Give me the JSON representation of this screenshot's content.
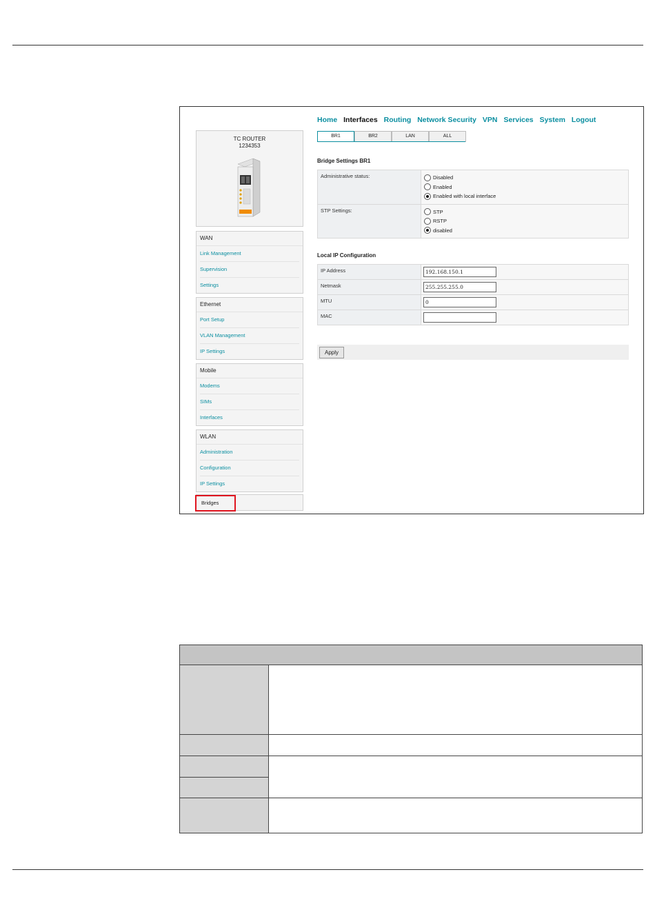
{
  "device": {
    "name": "TC ROUTER",
    "id": "1234353"
  },
  "nav": {
    "items": [
      "Home",
      "Interfaces",
      "Routing",
      "Network Security",
      "VPN",
      "Services",
      "System",
      "Logout"
    ],
    "active": "Interfaces"
  },
  "tabs": [
    "BR1",
    "BR2",
    "LAN",
    "ALL"
  ],
  "active_tab": "BR1",
  "sidebar": {
    "wan": {
      "header": "WAN",
      "items": [
        "Link Management",
        "Supervision",
        "Settings"
      ]
    },
    "ethernet": {
      "header": "Ethernet",
      "items": [
        "Port Setup",
        "VLAN Management",
        "IP Settings"
      ]
    },
    "mobile": {
      "header": "Mobile",
      "items": [
        "Modems",
        "SIMs",
        "Interfaces"
      ]
    },
    "wlan": {
      "header": "WLAN",
      "items": [
        "Administration",
        "Configuration",
        "IP Settings"
      ]
    },
    "bridges": "Bridges"
  },
  "bridge_settings": {
    "title": "Bridge Settings BR1",
    "admin_status": {
      "label": "Administrative status:",
      "options": [
        "Disabled",
        "Enabled",
        "Enabled with local interface"
      ],
      "selected": "Enabled with local interface"
    },
    "stp": {
      "label": "STP Settings:",
      "options": [
        "STP",
        "RSTP",
        "disabled"
      ],
      "selected": "disabled"
    }
  },
  "local_ip": {
    "title": "Local IP Configuration",
    "fields": {
      "ip_label": "IP Address",
      "ip_value": "192.168.150.1",
      "netmask_label": "Netmask",
      "netmask_value": "255.255.255.0",
      "mtu_label": "MTU",
      "mtu_value": "0",
      "mac_label": "MAC",
      "mac_value": ""
    }
  },
  "apply_label": "Apply",
  "colors": {
    "accent": "#0a8ea0",
    "highlight": "#e0141e"
  }
}
